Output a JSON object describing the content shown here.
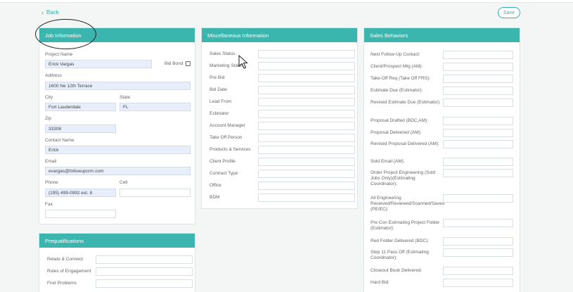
{
  "nav": {
    "back_label": "Back",
    "save_label": "Save"
  },
  "job_info": {
    "title": "Job Information",
    "project_name_label": "Project Name",
    "project_name_value": "Erick Vargas",
    "bid_bond_label": "Bid Bond",
    "address_label": "Address",
    "address_value": "1600 Ne 12th Terrace",
    "city_label": "City",
    "city_value": "Fort Lauderdale",
    "state_label": "State",
    "state_value": "FL",
    "zip_label": "Zip",
    "zip_value": "33308",
    "contact_name_label": "Contact Name",
    "contact_name_value": "Erick",
    "email_label": "Email",
    "email_value": "evargas@followupcrm.com",
    "phone_label": "Phone",
    "phone_value": "(195) 499-0992 ext. 8",
    "cell_label": "Cell",
    "cell_value": "",
    "fax_label": "Fax",
    "fax_value": ""
  },
  "prequal": {
    "title": "Prequalifications",
    "fields": [
      {
        "label": "Relate & Connect",
        "value": ""
      },
      {
        "label": "Rules of Engagement",
        "value": ""
      },
      {
        "label": "Find Problems",
        "value": ""
      }
    ]
  },
  "misc": {
    "title": "Miscellaneous Information",
    "fields": [
      {
        "label": "Sales Status",
        "value": ""
      },
      {
        "label": "Marketing Status",
        "value": ""
      },
      {
        "label": "Pre Bid",
        "value": ""
      },
      {
        "label": "Bid Date",
        "value": ""
      },
      {
        "label": "Lead From",
        "value": ""
      },
      {
        "label": "Estimator",
        "value": ""
      },
      {
        "label": "Account Manager",
        "value": ""
      },
      {
        "label": "Take Off Person",
        "value": ""
      },
      {
        "label": "Products & Services",
        "value": ""
      },
      {
        "label": "Client Profile",
        "value": ""
      },
      {
        "label": "Contract Type",
        "value": ""
      },
      {
        "label": "Office",
        "value": ""
      },
      {
        "label": "BDM",
        "value": ""
      }
    ]
  },
  "sales": {
    "title": "Sales Behaviors",
    "fields": [
      {
        "label": "Next Follow-Up Contact:",
        "value": ""
      },
      {
        "label": "Client/Prospect Mtg (AM):",
        "value": ""
      },
      {
        "label": "Take-Off Req (Take Off FRS):",
        "value": ""
      },
      {
        "label": "Estimate Due (Estimator):",
        "value": ""
      },
      {
        "label": "Revised Estimate Due (Estimator):",
        "value": ""
      },
      {
        "label": "Proposal Drafted (BDC,AM):",
        "value": ""
      },
      {
        "label": "Proposal Delivered (AM):",
        "value": ""
      },
      {
        "label": "Revised Proposal Delivered (AM):",
        "value": ""
      },
      {
        "label": "Sold Email (AM):",
        "value": ""
      },
      {
        "label": "Order Project Engineering (Sold Jobs Only)(Estimating Coordinator):",
        "value": ""
      },
      {
        "label": "All Engineering Received/Reviewed/Scanned/Saved (PE/EC):",
        "value": ""
      },
      {
        "label": "Pre Con Estimating Project Folder (Estimator):",
        "value": ""
      },
      {
        "label": "Red Folder Delivered (BDC):",
        "value": ""
      },
      {
        "label": "Step 11 Pass Off (Estimating Coordinator):",
        "value": ""
      },
      {
        "label": "Closeout Book Delivered:",
        "value": ""
      },
      {
        "label": "Hard Bid:",
        "value": ""
      }
    ]
  }
}
